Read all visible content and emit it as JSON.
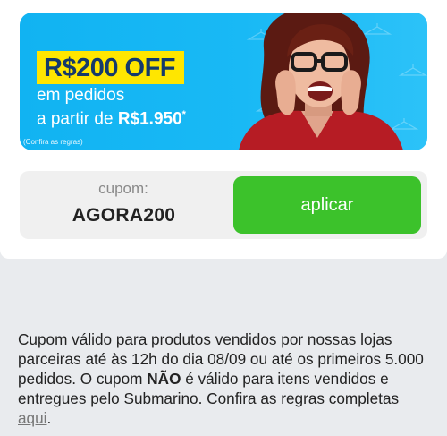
{
  "banner": {
    "discount": "R$200 OFF",
    "line1": "em pedidos",
    "line2_prefix": "a partir de ",
    "line2_amount": "R$1.950",
    "line2_mark": "*",
    "rules_note": "(Confira as regras)",
    "colors": {
      "background": "#11b3f2",
      "highlight": "#ffe600",
      "highlight_text": "#153a6b"
    }
  },
  "coupon": {
    "label": "cupom:",
    "code": "AGORA200",
    "apply_label": "aplicar",
    "apply_color": "#3cc22b"
  },
  "terms": {
    "part1": "Cupom válido para produtos vendidos por nossas lojas parceiras até às 12h do dia 08/09 ou até os primeiros 5.000 pedidos. O cupom ",
    "emphasis": "NÃO",
    "part2": " é válido para itens vendidos e entregues pelo Submarino. Confira as regras completas ",
    "link": "aqui",
    "end": "."
  }
}
